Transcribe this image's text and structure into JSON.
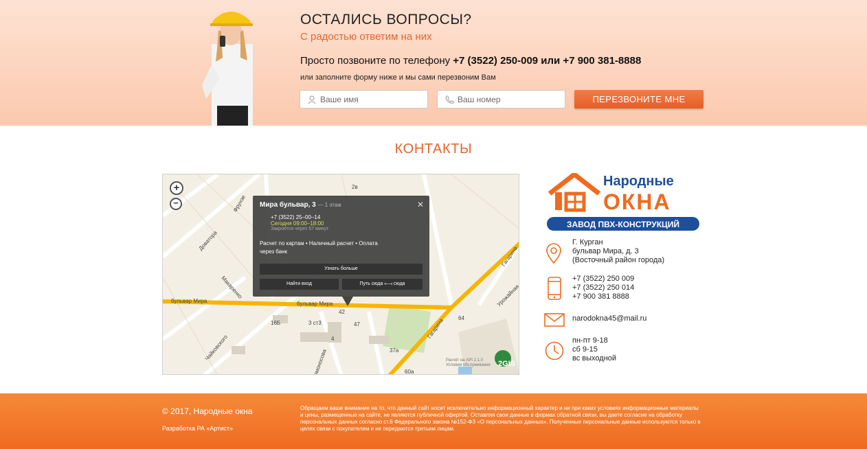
{
  "hero": {
    "title": "ОСТАЛИСЬ ВОПРОСЫ?",
    "subtitle": "С радостью ответим на них",
    "call_prefix": "Просто позвоните по телефону",
    "call_phones": "+7 (3522) 250-009 или +7 900 381-8888",
    "hint": "или заполните форму ниже и мы сами перезвоним Вам",
    "name_placeholder": "Ваше имя",
    "phone_placeholder": "Ваш номер",
    "button": "ПЕРЕЗВОНИТЕ МНЕ"
  },
  "contacts": {
    "title": "КОНТАКТЫ",
    "logo": {
      "line1": "Народные",
      "line2": "ОКНА",
      "ribbon": "ЗАВОД ПВХ-КОНСТРУКЦИЙ"
    },
    "address": [
      "Г. Курган",
      "бульвар Мира, д. 3",
      "(Восточный район города)"
    ],
    "phones": [
      "+7 (3522) 250 009",
      "+7 (3522) 250 014",
      "+7 900 381 8888"
    ],
    "email": "narodokna45@mail.ru",
    "hours": [
      "пн-пт 9-18",
      "сб 9-15",
      "вс выходной"
    ]
  },
  "map": {
    "popup": {
      "title": "Мира бульвар, 3",
      "floor": "— 1 этаж",
      "phone": "+7 (3522) 25–00–14",
      "today": "Сегодня 09:00–18:00",
      "closes": "Закроется через 57 минут",
      "payment": "Расчет по картам • Наличный расчет • Оплата через банк",
      "more": "Узнать больше",
      "entrance": "Найти вход",
      "route": "Путь сюда",
      "route_end": "сюда"
    },
    "streets": [
      "бульвар Мира",
      "бульвар Мира",
      "Доваторa",
      "Макаренко",
      "Чайковского",
      "Гагарина",
      "Гагарина",
      "Урожайная",
      "Фрунзе",
      "Ломоносова"
    ],
    "buildings": [
      "2в",
      "3 ст3",
      "16Б",
      "47",
      "42",
      "4",
      "37а",
      "60а",
      "64"
    ],
    "attribution": "Расчёт на API 2.1.0 Условия обслуживания",
    "brand": "2GIS"
  },
  "footer": {
    "copyright": "© 2017, Народные окна",
    "developer": "Разработка РА «Артист»",
    "legal": "Обращаем ваше внимание на то, что данный сайт носит исключительно информационный характер и ни при каких условиях информационные материалы и цены, размещенные на сайте, не являются публичной офертой. Оставляя свои данные в формах обратной связи, вы даете согласие на обработку персональных данных согласно ст.6 Федерального закона №152-ФЗ «О персональных данных». Полученные персональные данные используются только в целях связи с покупателем и не передаются третьим лицам."
  },
  "colors": {
    "accent": "#e8642c",
    "brand_blue": "#1d4f9c",
    "footer": "#f27a2c"
  }
}
